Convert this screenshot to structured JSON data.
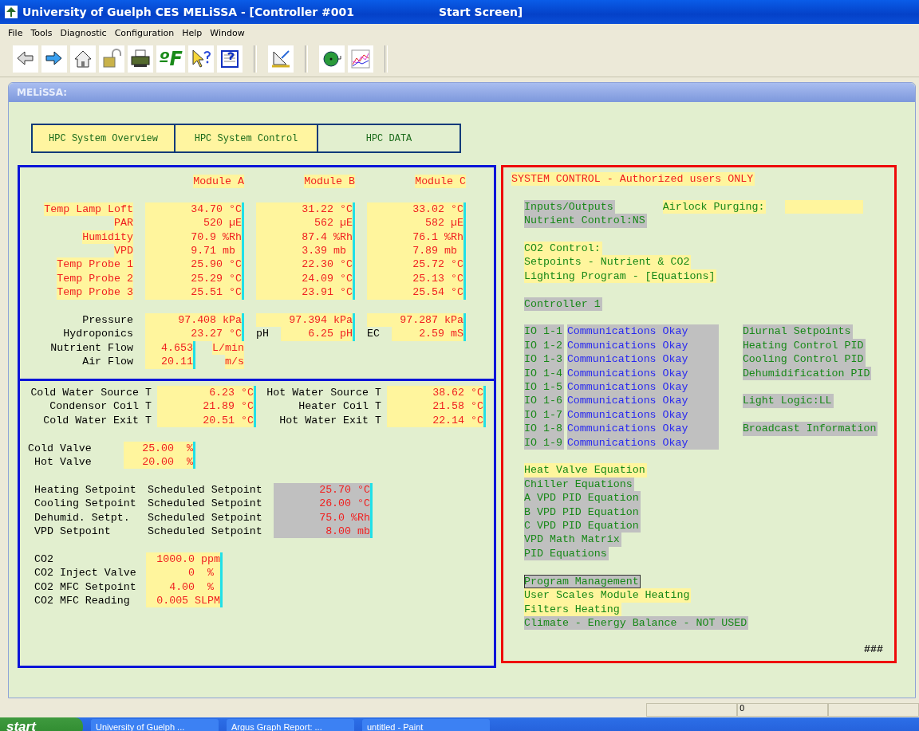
{
  "window": {
    "title": "University of Guelph CES MELiSSA - [Controller #001",
    "title_suffix": "Start Screen]"
  },
  "menu": [
    "File",
    "Tools",
    "Diagnostic",
    "Configuration",
    "Help",
    "Window"
  ],
  "toolbar": {
    "temperature_unit": "ºF"
  },
  "child_window": {
    "title": "MELiSSA:"
  },
  "nav_buttons": [
    "HPC System Overview",
    "HPC System Control",
    "HPC DATA"
  ],
  "module_readings": {
    "headers": [
      "Module A",
      "Module B",
      "Module C"
    ],
    "rows": [
      {
        "label": "Temp Lamp Loft",
        "values": [
          "34.70 °C",
          "31.22 °C",
          "33.02 °C"
        ]
      },
      {
        "label": "PAR",
        "values": [
          "520 µE",
          "562 µE",
          "582 µE"
        ]
      },
      {
        "label": "Humidity",
        "values": [
          "70.9 %Rh",
          "87.4 %Rh",
          "76.1 %Rh"
        ]
      },
      {
        "label": "VPD",
        "values": [
          "9.71 mb ",
          "3.39 mb ",
          "7.89 mb "
        ]
      },
      {
        "label": "Temp Probe 1",
        "values": [
          "25.90 °C",
          "22.30 °C",
          "25.72 °C"
        ]
      },
      {
        "label": "Temp Probe 2",
        "values": [
          "25.29 °C",
          "24.09 °C",
          "25.13 °C"
        ]
      },
      {
        "label": "Temp Probe 3",
        "values": [
          "25.51 °C",
          "23.91 °C",
          "25.54 °C"
        ]
      }
    ]
  },
  "pressure": {
    "label": "Pressure",
    "values": [
      "97.408 kPa",
      "97.394 kPa",
      "97.287 kPa"
    ]
  },
  "hydroponics": {
    "label": "Hydroponics",
    "value": "23.27 °C",
    "ph_label": "pH",
    "ph_value": "6.25 pH",
    "ec_label": "EC",
    "ec_value": "2.59 mS"
  },
  "flows": [
    {
      "label": "Nutrient Flow",
      "value": "4.653",
      "unit": "L/min"
    },
    {
      "label": "Air Flow",
      "value": "20.11",
      "unit": "m/s"
    }
  ],
  "water_temps": [
    {
      "label": "Cold Water Source T",
      "value": "6.23 °C"
    },
    {
      "label": "Hot Water Source T",
      "value": "38.62 °C"
    },
    {
      "label": "Condensor Coil T",
      "value": "21.89 °C"
    },
    {
      "label": "Heater Coil T",
      "value": "21.58 °C"
    },
    {
      "label": "Cold Water Exit T",
      "value": "20.51 °C"
    },
    {
      "label": "Hot Water Exit T",
      "value": "22.14 °C"
    }
  ],
  "valves": [
    {
      "label": "Cold Valve",
      "value": "25.00  %"
    },
    {
      "label": "Hot Valve",
      "value": "20.00  %"
    }
  ],
  "setpoints": [
    {
      "label": "Heating Setpoint",
      "source": "Scheduled Setpoint",
      "value": "25.70 °C"
    },
    {
      "label": "Cooling Setpoint",
      "source": "Scheduled Setpoint",
      "value": "26.00 °C"
    },
    {
      "label": "Dehumid. Setpt.",
      "source": "Scheduled Setpoint",
      "value": "75.0 %Rh"
    },
    {
      "label": "VPD Setpoint",
      "source": "Scheduled Setpoint",
      "value": "8.00 mb"
    }
  ],
  "co2": [
    {
      "label": "CO2",
      "value": "1000.0 ppm"
    },
    {
      "label": "CO2 Inject Valve",
      "value": "0  % "
    },
    {
      "label": "CO2 MFC Setpoint",
      "value": "4.00  % "
    },
    {
      "label": "CO2 MFC Reading",
      "value": "0.005 SLPM"
    }
  ],
  "system_control": {
    "heading": "SYSTEM CONTROL - Authorized users ONLY",
    "airlock_label": "Airlock Purging:",
    "groups": [
      [
        {
          "label": "Inputs/Outputs",
          "highlighted": false,
          "focused": false
        },
        {
          "label": "Nutrient Control:NS",
          "highlighted": false,
          "focused": false
        }
      ],
      [
        {
          "label": "CO2 Control:",
          "highlighted": true,
          "focused": false
        },
        {
          "label": "Setpoints - Nutrient & CO2",
          "highlighted": true,
          "focused": false
        },
        {
          "label": "Lighting Program - [Equations]",
          "highlighted": true,
          "focused": false
        }
      ],
      [
        {
          "label": "Controller 1",
          "highlighted": false,
          "focused": false
        }
      ]
    ],
    "io_rows": [
      {
        "io": "IO 1-1",
        "status": "Communications Okay"
      },
      {
        "io": "IO 1-2",
        "status": "Communications Okay"
      },
      {
        "io": "IO 1-3",
        "status": "Communications Okay"
      },
      {
        "io": "IO 1-4",
        "status": "Communications Okay"
      },
      {
        "io": "IO 1-5",
        "status": "Communications Okay"
      },
      {
        "io": "IO 1-6",
        "status": "Communications Okay"
      },
      {
        "io": "IO 1-7",
        "status": "Communications Okay"
      },
      {
        "io": "IO 1-8",
        "status": "Communications Okay"
      },
      {
        "io": "IO 1-9",
        "status": "Communications Okay"
      }
    ],
    "side_groups": [
      [
        "Diurnal Setpoints",
        "Heating Control PID",
        "Cooling Control PID",
        "Dehumidification PID"
      ],
      [
        "Light Logic:LL"
      ],
      [
        "Broadcast Information"
      ]
    ],
    "lower_groups": [
      [
        {
          "label": "Heat Valve Equation",
          "highlighted": true,
          "focused": false
        },
        {
          "label": "Chiller Equations",
          "highlighted": false,
          "focused": false
        },
        {
          "label": "A VPD PID Equation",
          "highlighted": false,
          "focused": false
        },
        {
          "label": "B VPD PID Equation",
          "highlighted": false,
          "focused": false
        },
        {
          "label": "C VPD PID Equation",
          "highlighted": false,
          "focused": false
        },
        {
          "label": "VPD Math Matrix",
          "highlighted": false,
          "focused": false
        },
        {
          "label": "PID Equations",
          "highlighted": false,
          "focused": false
        }
      ],
      [
        {
          "label": "Program Management",
          "highlighted": false,
          "focused": true
        },
        {
          "label": "User Scales Module Heating",
          "highlighted": true,
          "focused": false
        },
        {
          "label": "Filters Heating",
          "highlighted": true,
          "focused": false
        },
        {
          "label": "Climate - Energy Balance - NOT USED",
          "highlighted": false,
          "focused": false
        }
      ]
    ],
    "footer": "###"
  },
  "status_bar": {
    "count": "0"
  },
  "taskbar": {
    "start": "start",
    "tasks": [
      "University of Guelph ...",
      "Argus Graph Report: ...",
      "untitled - Paint"
    ]
  }
}
